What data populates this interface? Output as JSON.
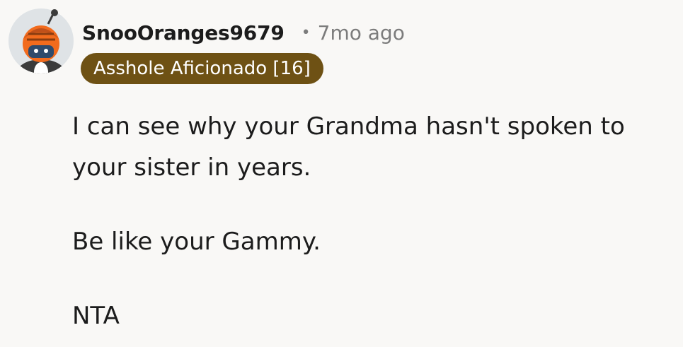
{
  "comment": {
    "username": "SnooOranges9679",
    "separator": "•",
    "timestamp": "7mo ago",
    "flair": "Asshole Aficionado [16]",
    "paragraphs": [
      "I can see why your Grandma hasn't spoken to your sister in years.",
      "Be like your Gammy.",
      "NTA"
    ],
    "avatar_icon": "snoo-avatar-icon"
  },
  "colors": {
    "background": "#f9f8f6",
    "flair_background": "#6e5114",
    "flair_text": "#ffffff",
    "meta_text": "#7c7c7c"
  }
}
